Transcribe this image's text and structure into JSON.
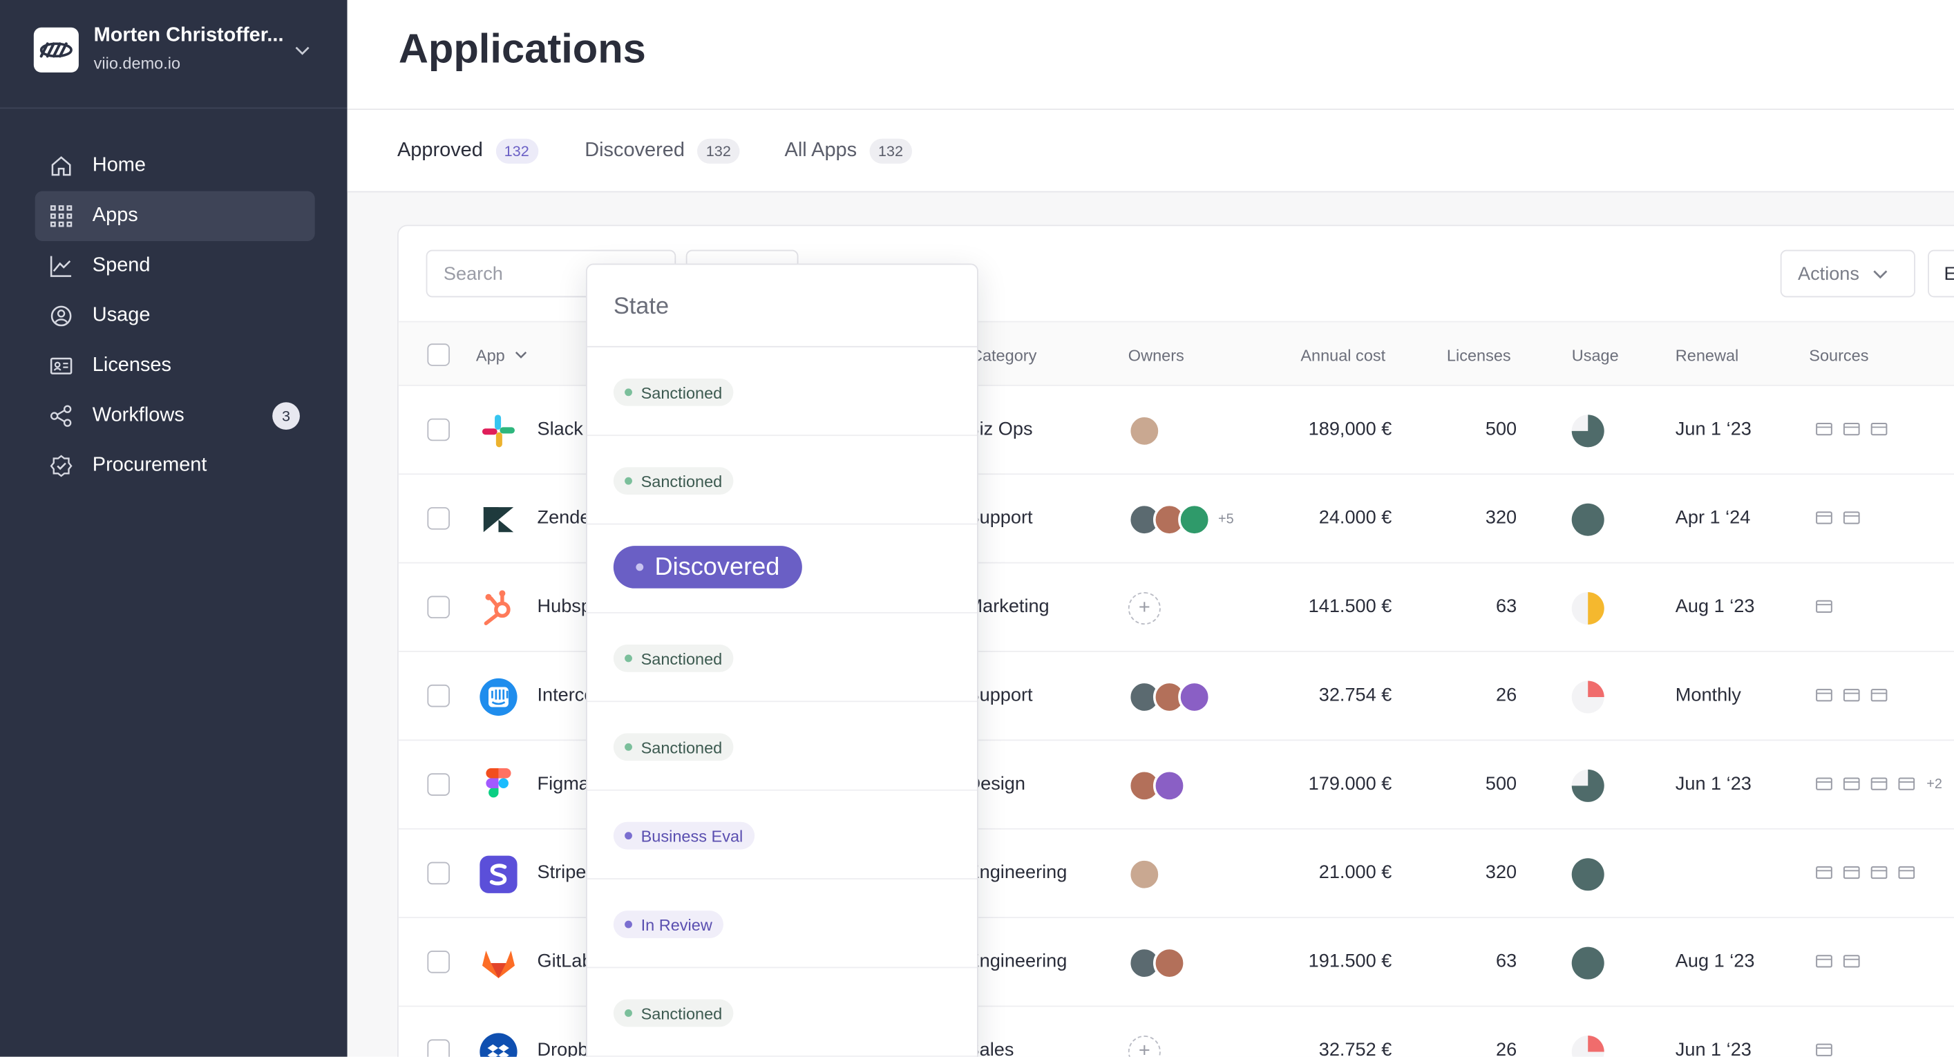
{
  "org": {
    "name": "Morten Christoffer...",
    "domain": "viio.demo.io"
  },
  "nav": [
    {
      "label": "Home",
      "icon": "home-icon"
    },
    {
      "label": "Apps",
      "icon": "apps-grid-icon"
    },
    {
      "label": "Spend",
      "icon": "chart-line-icon"
    },
    {
      "label": "Usage",
      "icon": "usage-icon"
    },
    {
      "label": "Licenses",
      "icon": "license-card-icon"
    },
    {
      "label": "Workflows",
      "icon": "workflow-icon",
      "badge": "3"
    },
    {
      "label": "Procurement",
      "icon": "procurement-badge-icon"
    }
  ],
  "page": {
    "title": "Applications"
  },
  "tabs": [
    {
      "label": "Approved",
      "count": "132"
    },
    {
      "label": "Discovered",
      "count": "132"
    },
    {
      "label": "All Apps",
      "count": "132"
    }
  ],
  "toolbar": {
    "search_placeholder": "Search",
    "actions_label": "Actions",
    "export_label": "E"
  },
  "columns": {
    "app": "App",
    "category": "Category",
    "owners": "Owners",
    "annual_cost": "Annual cost",
    "licenses": "Licenses",
    "usage": "Usage",
    "renewal": "Renewal",
    "sources": "Sources"
  },
  "rows": [
    {
      "name": "Slack",
      "category": "Biz Ops",
      "cost": "189,000 €",
      "licenses": "500",
      "renewal": "Jun 1 ‘23",
      "usage": 0.75,
      "usage_color": "#4f6b6a",
      "owners_more": ""
    },
    {
      "name": "Zendesk",
      "category": "Support",
      "cost": "24.000 €",
      "licenses": "320",
      "renewal": "Apr 1 ‘24",
      "usage": 1.0,
      "usage_color": "#4f6b6a",
      "owners_more": "+5"
    },
    {
      "name": "Hubspot",
      "category": "Marketing",
      "cost": "141.500 €",
      "licenses": "63",
      "renewal": "Aug 1 ‘23",
      "usage": 0.5,
      "usage_color": "#f5b82e",
      "owners_more": ""
    },
    {
      "name": "Intercom",
      "category": "Support",
      "cost": "32.754 €",
      "licenses": "26",
      "renewal": "Monthly",
      "usage": 0.25,
      "usage_color": "#f06c6c",
      "owners_more": ""
    },
    {
      "name": "Figma",
      "category": "Design",
      "cost": "179.000 €",
      "licenses": "500",
      "renewal": "Jun 1 ‘23",
      "usage": 0.75,
      "usage_color": "#4f6b6a",
      "owners_more": "",
      "sources_more": "+2"
    },
    {
      "name": "Stripe",
      "category": "Engineering",
      "cost": "21.000 €",
      "licenses": "320",
      "renewal": "",
      "usage": 1.0,
      "usage_color": "#4f6b6a",
      "owners_more": ""
    },
    {
      "name": "GitLab",
      "category": "Engineering",
      "cost": "191.500 €",
      "licenses": "63",
      "renewal": "Aug 1 ‘23",
      "usage": 1.0,
      "usage_color": "#4f6b6a",
      "owners_more": ""
    },
    {
      "name": "Dropbox",
      "category": "Sales",
      "cost": "32.752 €",
      "licenses": "26",
      "renewal": "Jun 1 ‘23",
      "usage": 0.25,
      "usage_color": "#f06c6c",
      "owners_more": ""
    }
  ],
  "state_dropdown": {
    "title": "State",
    "options": [
      {
        "label": "Sanctioned",
        "style": "sanctioned"
      },
      {
        "label": "Sanctioned",
        "style": "sanctioned"
      },
      {
        "label": "Discovered",
        "style": "selected"
      },
      {
        "label": "Sanctioned",
        "style": "sanctioned"
      },
      {
        "label": "Sanctioned",
        "style": "sanctioned"
      },
      {
        "label": "Business Eval",
        "style": "purple"
      },
      {
        "label": "In Review",
        "style": "purple"
      },
      {
        "label": "Sanctioned",
        "style": "sanctioned"
      }
    ]
  },
  "colors": {
    "sidebar_bg": "#2c3244",
    "accent": "#6a5fc5",
    "usage_teal": "#4f6b6a",
    "usage_yellow": "#f5b82e",
    "usage_red": "#f06c6c"
  }
}
